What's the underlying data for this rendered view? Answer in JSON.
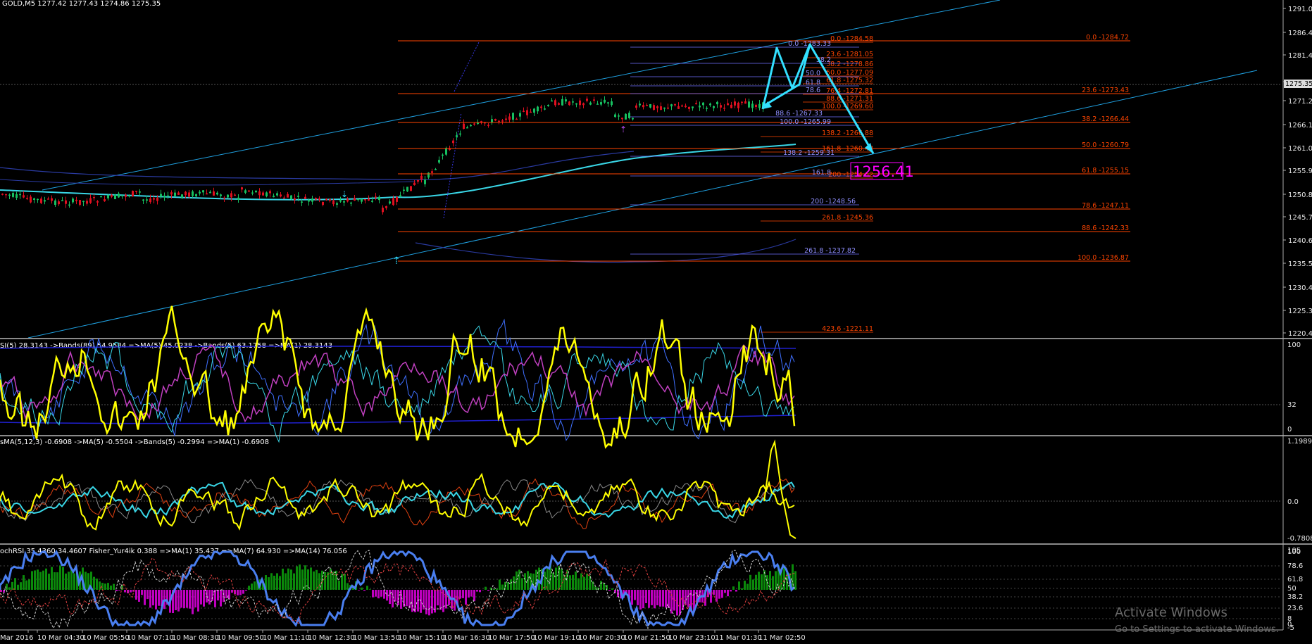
{
  "window": {
    "symbol_header": "GOLD,M5  1277.42 1277.43 1274.86 1275.35"
  },
  "price_axis": {
    "labels": [
      "1291.05",
      "1286.40",
      "1281.45",
      "1276.35",
      "1271.25",
      "1266.15",
      "1261.05",
      "1255.90",
      "1250.85",
      "1245.75",
      "1240.65",
      "1235.55",
      "1230.45",
      "1225.35",
      "1220.40"
    ],
    "current_price": "1275.35",
    "big_price_box": "1256.41"
  },
  "time_axis": {
    "labels": [
      "Mar 2016",
      "10 Mar 04:30",
      "10 Mar 05:50",
      "10 Mar 07:10",
      "10 Mar 08:30",
      "10 Mar 09:50",
      "10 Mar 11:10",
      "10 Mar 12:30",
      "10 Mar 13:50",
      "10 Mar 15:10",
      "10 Mar 16:30",
      "10 Mar 17:50",
      "10 Mar 19:10",
      "10 Mar 20:30",
      "10 Mar 21:50",
      "10 Mar 23:10",
      "11 Mar 01:30",
      "11 Mar 02:50"
    ]
  },
  "fibo_red_right": [
    {
      "label": "0.0 -1284.72"
    },
    {
      "label": "23.6 -1273.43"
    },
    {
      "label": "38.2 -1266.44"
    },
    {
      "label": "50.0 -1260.79"
    },
    {
      "label": "61.8 -1255.15"
    },
    {
      "label": "78.6 -1247.11"
    },
    {
      "label": "88.6 -1242.33"
    },
    {
      "label": "100.0 -1236.87"
    }
  ],
  "fibo_red_mid": [
    {
      "label": "0.0 -1284.58"
    },
    {
      "label": "23.6 -1281.05"
    },
    {
      "label": "38.2 -1278.86"
    },
    {
      "label": "50.0 -1277.09"
    },
    {
      "label": "61.8 -1275.32"
    },
    {
      "label": "76.4 -1272.81"
    },
    {
      "label": "88.6 -1271.31"
    },
    {
      "label": "100.0 -1269.60"
    },
    {
      "label": "138.2 -1266.88"
    },
    {
      "label": "161.8 -1260.43"
    },
    {
      "label": "200 -1254.62"
    },
    {
      "label": "261.8 -1245.36"
    },
    {
      "label": "423.6 -1221.11"
    }
  ],
  "fibo_blue": [
    {
      "label": "0.0 -1283.33"
    },
    {
      "label": "38.2"
    },
    {
      "label": "50.0"
    },
    {
      "label": "61.8"
    },
    {
      "label": "78.6"
    },
    {
      "label": "88.6 -1267.33"
    },
    {
      "label": "100.0 -1265.99"
    },
    {
      "label": "138.2 -1259.31"
    },
    {
      "label": "161.8"
    },
    {
      "label": "200 -1248.56"
    },
    {
      "label": "261.8 -1237.82"
    }
  ],
  "panels": {
    "rsi": {
      "header": "SI(5) 28.3143  ->Bands(89) 54.9584  =>MA(5) 45.0238  ->Bands(5) 63.1758  =>MA(1) 28.3143",
      "levels": [
        "100",
        "32",
        "0"
      ]
    },
    "osma": {
      "header": "sMA(5,12,3) -0.6908  ->MA(5) -0.5504  ->Bands(5) -0.2994  =>MA(1) -0.6908",
      "levels": [
        "1.1989",
        "0.0",
        "-0.7808"
      ]
    },
    "stoch": {
      "header": "ochRSI 35.4360 34.4607  Fisher_Yur4ik  0.388  =>MA(1) 35.437  =>MA(7) 64.930  =>MA(14) 76.056",
      "levels": [
        "105",
        "100",
        "78.6",
        "61.8",
        "50",
        "38.2",
        "23.6",
        "8",
        "0",
        "-5"
      ]
    }
  },
  "watermark": {
    "title": "Activate Windows",
    "subtitle": "Go to Settings to activate Windows."
  },
  "colors": {
    "background": "#000000",
    "fibo_red": "#ff4500",
    "fibo_blue": "#6f6fff",
    "channel": "#1fa0e0",
    "pattern": "#33e0ff",
    "rsi_main": "#ffff00",
    "osc_cyan": "#39d6e6",
    "stoch_blue": "#4a7ff0",
    "hist_green": "#0b8a0b",
    "hist_magenta": "#c000c0"
  }
}
